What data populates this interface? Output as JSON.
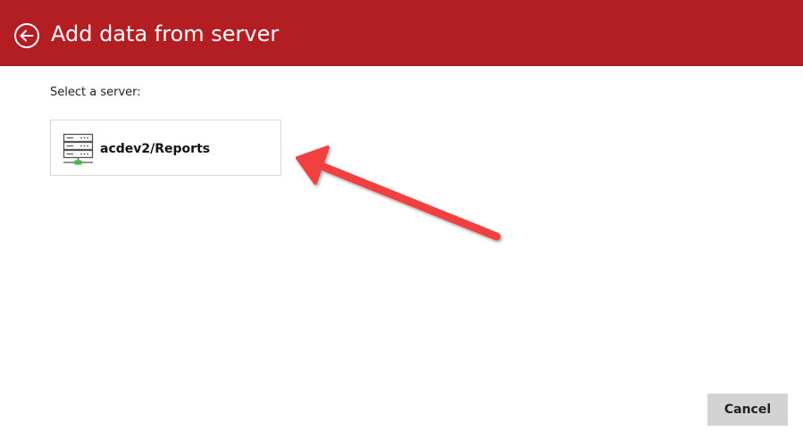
{
  "header": {
    "title": "Add data from server",
    "background_color": "#b31e23",
    "back_icon": "circle-arrow-left-icon"
  },
  "main": {
    "select_label": "Select a server:",
    "servers": [
      {
        "name": "acdev2/Reports",
        "icon": "server-network-icon"
      }
    ]
  },
  "annotation": {
    "type": "arrow",
    "color": "#f04040",
    "points_to": "server tile"
  },
  "footer": {
    "cancel_label": "Cancel"
  }
}
